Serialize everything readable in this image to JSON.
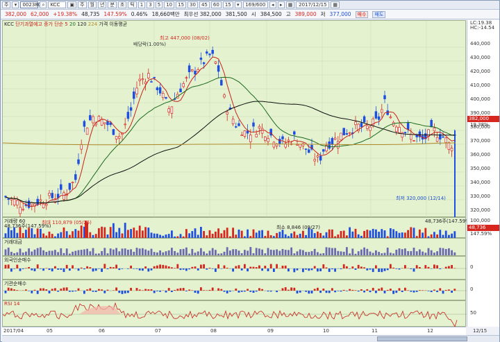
{
  "toolbar": {
    "tab_label": "주",
    "code": "002380",
    "stock_name": "KCC",
    "periods": [
      "주",
      "월",
      "년",
      "분",
      "초",
      "틱"
    ],
    "intervals": [
      "1",
      "3",
      "5",
      "10",
      "15",
      "30",
      "45",
      "60",
      "15"
    ],
    "count": "169/600",
    "date": "2017/12/15"
  },
  "quote": {
    "price": "382,000",
    "change": "62,000",
    "rate": "+19.38%",
    "volume": "48,735",
    "vol_rate": "147.59%",
    "vol_change": "0.46%",
    "amount": "18,660백만",
    "prev": "최우선 382,000",
    "ask": "381,500",
    "bid_label": "시",
    "open": "384,500",
    "high_label": "고",
    "high": "389,000",
    "low_label": "저",
    "low": "377,000",
    "buy_label": "매수",
    "sell_label": "매도"
  },
  "main_panel": {
    "legend": {
      "kcc": "KCC",
      "item1": "단기과열예고",
      "ma_label": "종가 단순 5",
      "ma20": "20",
      "ma120": "120",
      "ma224": "224",
      "ma_suffix": "가격 이동평균"
    },
    "annotations": {
      "high": "최고 447,000 (08/02)",
      "dividend": "배당락(1.00%)",
      "low": "최저 320,000 (12/14)"
    },
    "axis_top": [
      "LC:19.38",
      "HC:-14.54"
    ],
    "ticks": [
      "440,000",
      "430,000",
      "420,000",
      "410,000",
      "400,000",
      "390,000",
      "380,000",
      "370,000",
      "360,000",
      "350,000",
      "340,000",
      "330,000",
      "320,000"
    ],
    "price_tag": "382,000",
    "rate_tag": "19.38%"
  },
  "volume_panel": {
    "title": "거래량 60",
    "sub": "48,736주(147.59%)",
    "max_label": "최대 110,879 (05/25)",
    "min_label": "최소 8,846 (09/27)",
    "right_label": "48,736주(147.59%)",
    "ticks": [
      "100,000",
      "50,000"
    ],
    "tag": "48,736",
    "tag2": "147.59%"
  },
  "inst_panels": [
    {
      "title": "거래대금"
    },
    {
      "title": "외국인순매수",
      "tick": "0"
    },
    {
      "title": "기관순매수",
      "tick": "0"
    }
  ],
  "rsi_panel": {
    "title": "RSI 14",
    "ticks": [
      "50"
    ]
  },
  "xaxis": [
    "2017/04",
    "05",
    "06",
    "07",
    "08",
    "09",
    "10",
    "11",
    "12",
    "12/15"
  ],
  "colors": {
    "up": "#d7261e",
    "down": "#1f4fe0",
    "ma5": "#c8201a",
    "ma20": "#1d6a1d",
    "ma120": "#111111",
    "ma224": "#b08a2a",
    "bg": "#e4f2cf"
  }
}
